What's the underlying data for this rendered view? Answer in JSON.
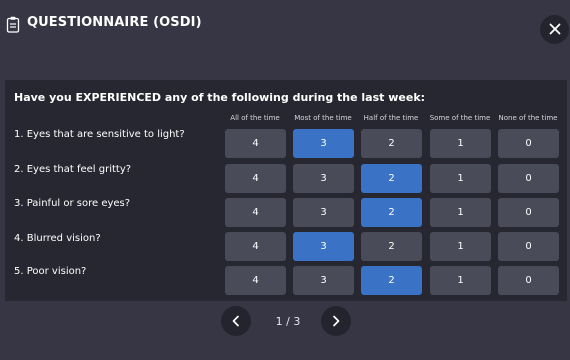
{
  "header": {
    "title": "QUESTIONNAIRE (OSDI)",
    "icon": "clipboard-icon",
    "close_icon": "close-icon"
  },
  "colors": {
    "background": "#363645",
    "panel": "#272731",
    "option": "#4a4b59",
    "selected": "#3a72c6"
  },
  "questionnaire": {
    "heading": "Have you EXPERIENCED any of the following during the last week:",
    "columns": [
      "All of the time",
      "Most of the time",
      "Half of the time",
      "Some of the time",
      "None of the time"
    ],
    "options": [
      "4",
      "3",
      "2",
      "1",
      "0"
    ],
    "rows": [
      {
        "label": "1. Eyes that are sensitive to light?",
        "selected": "3"
      },
      {
        "label": "2. Eyes that feel gritty?",
        "selected": "2"
      },
      {
        "label": "3. Painful or sore eyes?",
        "selected": "2"
      },
      {
        "label": "4. Blurred vision?",
        "selected": "3"
      },
      {
        "label": "5. Poor vision?",
        "selected": "2"
      }
    ]
  },
  "pagination": {
    "indicator": "1 / 3",
    "prev_icon": "chevron-left-icon",
    "next_icon": "chevron-right-icon"
  }
}
